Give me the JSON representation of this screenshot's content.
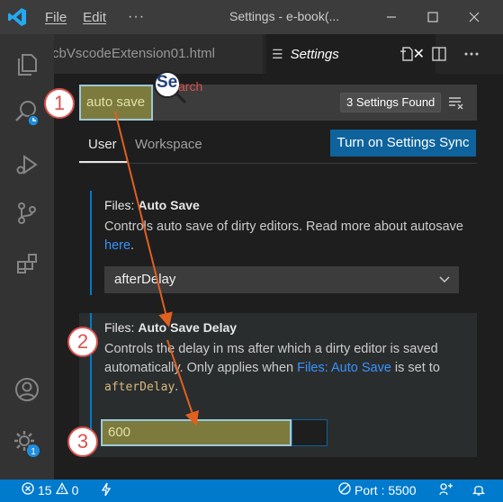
{
  "titlebar": {
    "menu_file": "File",
    "menu_edit": "Edit",
    "menu_more": "···",
    "title": "Settings - e-book(..."
  },
  "tabs": {
    "inactive_label": "cbVscodeExtension01.html",
    "active_label": "Settings",
    "active_icon": "settings-list-icon",
    "close_glyph": "✕"
  },
  "search": {
    "query": "auto save",
    "result_count": "3 Settings Found",
    "clear_icon": "clear-filter-icon"
  },
  "scope": {
    "user": "User",
    "workspace": "Workspace",
    "sync_button": "Turn on Settings Sync"
  },
  "settings": [
    {
      "category": "Files: ",
      "name": "Auto Save",
      "description_pre": "Controls auto save of dirty editors. Read more about autosave ",
      "description_link": "here",
      "description_post": ".",
      "value": "afterDelay"
    },
    {
      "category": "Files: ",
      "name": "Auto Save Delay",
      "description_pre": "Controls the delay in ms after which a dirty editor is saved automatically. Only applies when ",
      "description_link": "Files: Auto Save",
      "description_mid": " is set to ",
      "description_code": "afterDelay",
      "description_post": ".",
      "value": "600"
    }
  ],
  "statusbar": {
    "errors": "15",
    "warnings": "0",
    "port": "Port : 5500"
  },
  "annotations": {
    "step1": "1",
    "step2": "2",
    "step3": "3",
    "lens_se": "Se",
    "lens_arch": "arch"
  },
  "colors": {
    "accent": "#007acc",
    "highlight": "#7d7a3e",
    "callout": "#d9534f"
  }
}
